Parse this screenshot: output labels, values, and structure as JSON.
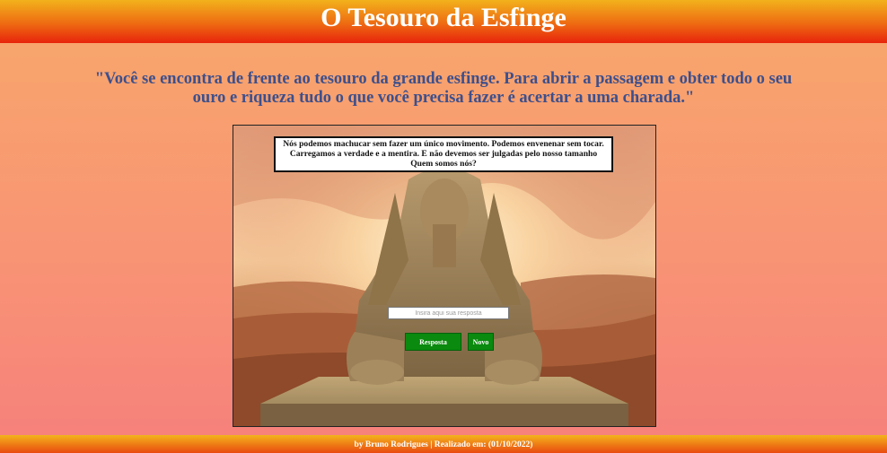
{
  "header": {
    "title": "O Tesouro da Esfinge"
  },
  "intro": {
    "text": "\"Você se encontra de frente ao tesouro da grande esfinge. Para abrir a passagem e obter todo o seu ouro e riqueza tudo o que você precisa fazer é acertar a uma charada.\""
  },
  "riddle": {
    "text": "Nós podemos machucar sem fazer um único movimento. Podemos envenenar sem tocar. Carregamos a verdade e a mentira. E não devemos ser julgadas pelo nosso tamanho Quem somos nós?"
  },
  "form": {
    "answer_placeholder": "Insira aqui sua resposta",
    "answer_value": "",
    "answer_button": "Resposta",
    "new_button": "Novo"
  },
  "footer": {
    "text": "by Bruno Rodrigues | Realizado em: (01/10/2022)"
  },
  "colors": {
    "header_top": "#f2b21c",
    "header_bottom": "#e8240c",
    "intro_text": "#3d4f8c",
    "button_green": "#0a8a0e",
    "background_top": "#f8a86b",
    "background_bottom": "#f6807c"
  },
  "illustration": {
    "subject": "sphinx-statue"
  }
}
